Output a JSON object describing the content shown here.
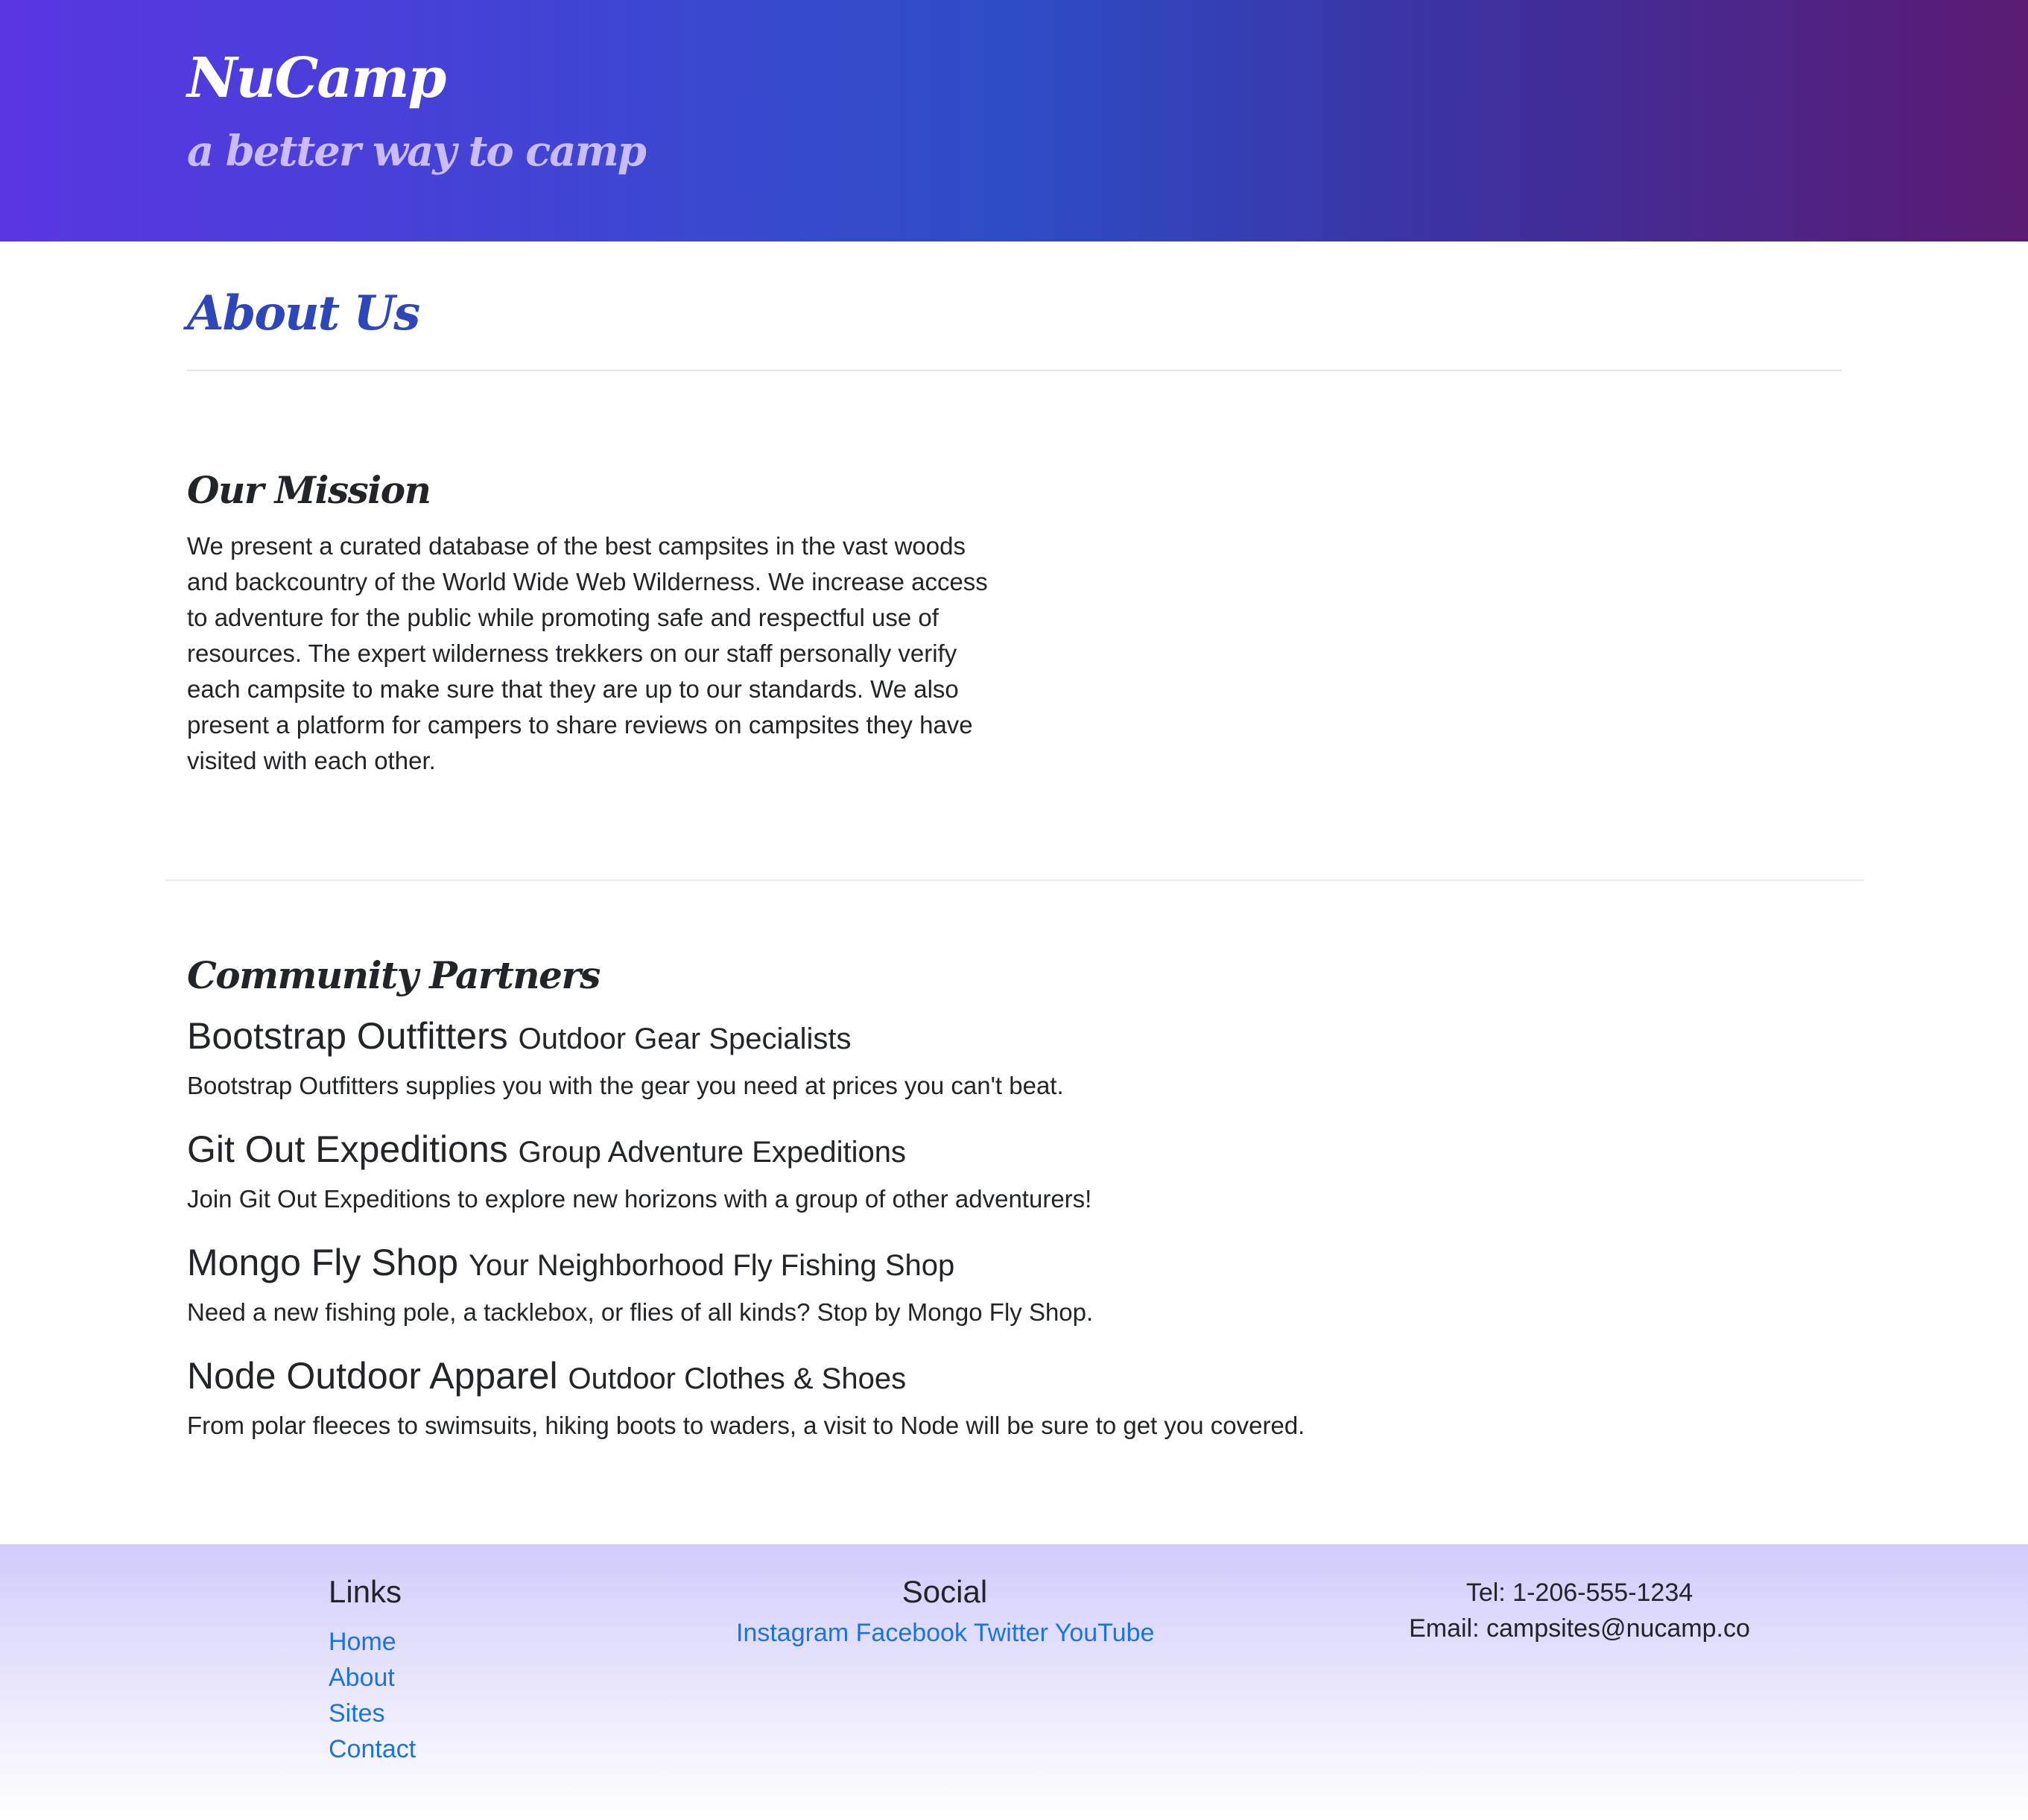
{
  "header": {
    "brand": "NuCamp",
    "tagline": "a better way to camp"
  },
  "main": {
    "title": "About Us",
    "mission": {
      "heading": "Our Mission",
      "text": "We present a curated database of the best campsites in the vast woods and backcountry of the World Wide Web Wilderness. We increase access to adventure for the public while promoting safe and respectful use of resources. The expert wilderness trekkers on our staff personally verify each campsite to make sure that they are up to our standards. We also present a platform for campers to share reviews on campsites they have visited with each other."
    },
    "partners": {
      "heading": "Community Partners",
      "items": [
        {
          "name": "Bootstrap Outfitters",
          "subtitle": "Outdoor Gear Specialists",
          "description": "Bootstrap Outfitters supplies you with the gear you need at prices you can't beat."
        },
        {
          "name": "Git Out Expeditions",
          "subtitle": "Group Adventure Expeditions",
          "description": "Join Git Out Expeditions to explore new horizons with a group of other adventurers!"
        },
        {
          "name": "Mongo Fly Shop",
          "subtitle": "Your Neighborhood Fly Fishing Shop",
          "description": "Need a new fishing pole, a tacklebox, or flies of all kinds? Stop by Mongo Fly Shop."
        },
        {
          "name": "Node Outdoor Apparel",
          "subtitle": "Outdoor Clothes & Shoes",
          "description": "From polar fleeces to swimsuits, hiking boots to waders, a visit to Node will be sure to get you covered."
        }
      ]
    }
  },
  "footer": {
    "links": {
      "heading": "Links",
      "items": [
        "Home",
        "About",
        "Sites",
        "Contact"
      ]
    },
    "social": {
      "heading": "Social",
      "items": [
        "Instagram",
        "Facebook",
        "Twitter",
        "YouTube"
      ]
    },
    "contact": {
      "tel": "Tel: 1-206-555-1234",
      "email": "Email: campsites@nucamp.co"
    }
  },
  "colors": {
    "link": "#1c73e0",
    "title_accent": "#2d47b8",
    "tagline": "#cabcfa",
    "footer_top": "#d0cbfb"
  }
}
